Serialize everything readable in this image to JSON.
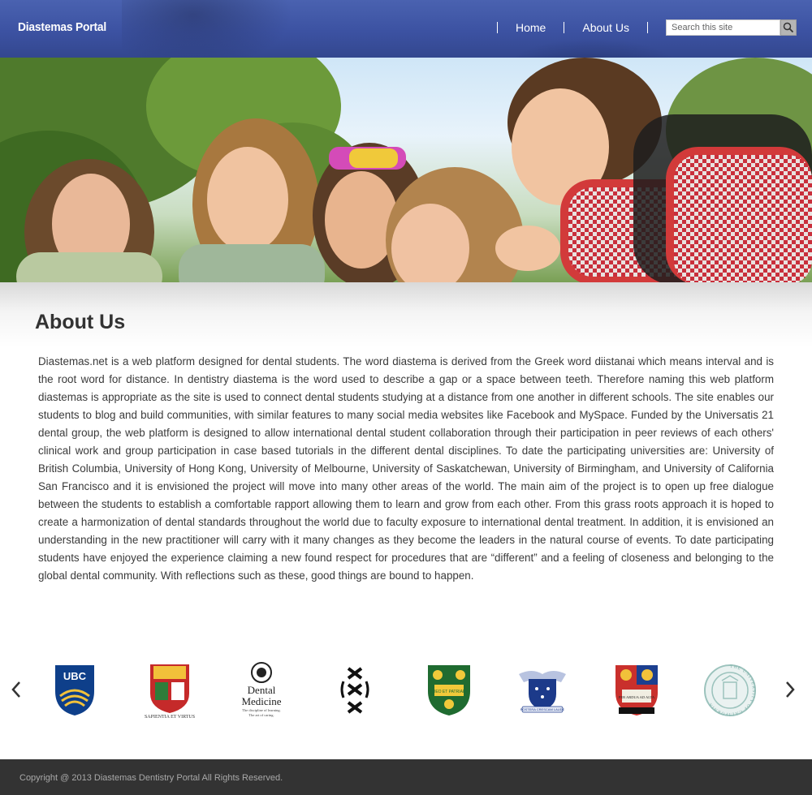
{
  "header": {
    "brand": "Diastemas Portal",
    "nav": [
      {
        "label": "Home"
      },
      {
        "label": "About Us"
      }
    ],
    "search": {
      "placeholder": "Search this site",
      "icon": "search-icon"
    }
  },
  "hero": {
    "image": "students-smiling-photo"
  },
  "main": {
    "title": "About Us",
    "body": "Diastemas.net is a web platform designed for dental students. The word diastema is derived from the Greek word diistanai which means interval and is the root word for distance. In dentistry diastema is the word used to describe a gap or a space between teeth. Therefore naming this web platform diastemas is appropriate as the site is used to connect dental students studying at a distance from one another in different schools. The site enables our students to blog and build communities, with similar features to many social media websites like Facebook and MySpace. Funded by the Universatis 21 dental group, the web platform is designed to allow international dental student collaboration through their participation in peer reviews of each others' clinical work and group participation in case based tutorials in the different dental disciplines. To date the participating universities are: University of British Columbia, University of Hong Kong, University of Melbourne, University of Saskatchewan, University of Birmingham, and University of California San Francisco and it is envisioned the project will move into many other areas of the world. The main aim of the project is to open up free dialogue between the students to establish a comfortable rapport allowing them to learn and grow from each other. From this grass roots approach it is hoped to create a harmonization of dental standards throughout the world due to faculty exposure to international dental treatment.  In addition, it is envisioned an understanding in the new practitioner will carry with it many changes as they become the leaders in the natural course of events. To date participating students have enjoyed the experience claiming a new found respect for procedures that are “different” and a feeling of closeness and belonging to the global dental community. With reflections such as these, good things are bound to happen."
  },
  "carousel": {
    "prev_icon": "chevron-left-icon",
    "next_icon": "chevron-right-icon",
    "logos": [
      {
        "name": "ubc-logo",
        "text": "UBC"
      },
      {
        "name": "hku-logo",
        "text": "SAPIENTIA ET VIRTUS"
      },
      {
        "name": "dental-medicine-logo",
        "title": "Dental",
        "title2": "Medicine",
        "tag1": "The discipline of learning.",
        "tag2": "The art of caring."
      },
      {
        "name": "uva-logo"
      },
      {
        "name": "usask-logo",
        "text": "DEO ET PATRIAE"
      },
      {
        "name": "melbourne-logo",
        "text": "POSTERA CRESCAM LAUDE"
      },
      {
        "name": "birmingham-logo",
        "text": "PER ARDUA AD ALTA"
      },
      {
        "name": "uc-seal-logo",
        "text": "THE UNIVERSITY OF CALIFORNIA"
      }
    ]
  },
  "footer": {
    "copyright": "Copyright @ 2013 Diastemas Dentistry Portal All Rights Reserved."
  },
  "colors": {
    "header": "#3c52a2",
    "footer": "#333333",
    "text": "#3a3a3a"
  }
}
